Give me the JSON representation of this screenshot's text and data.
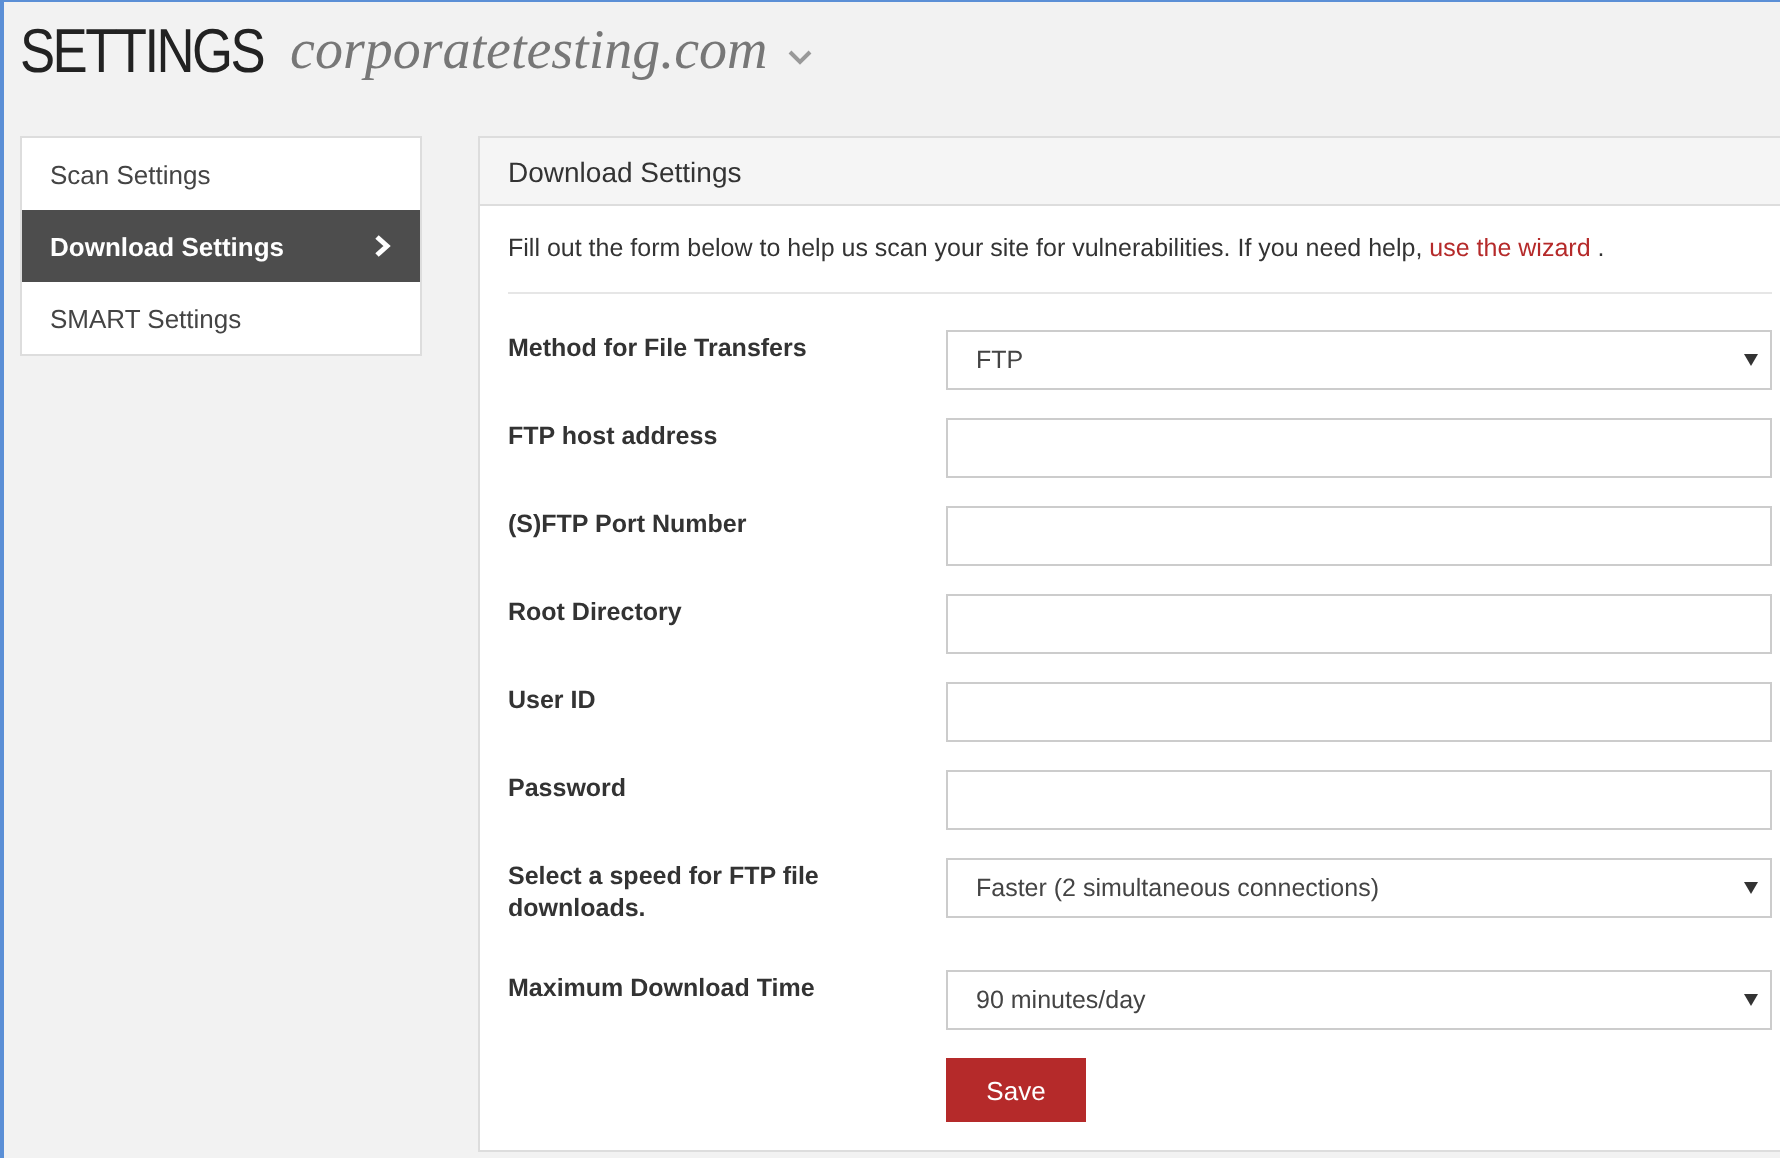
{
  "header": {
    "title": "SETTINGS",
    "site": "corporatetesting.com"
  },
  "sidebar": {
    "items": [
      {
        "label": "Scan Settings",
        "selected": false
      },
      {
        "label": "Download Settings",
        "selected": true
      },
      {
        "label": "SMART Settings",
        "selected": false
      }
    ]
  },
  "panel": {
    "title": "Download Settings",
    "description": {
      "text": "Fill out the form below to help us scan your site for vulnerabilities. If you need help, ",
      "link": "use the wizard",
      "after": " ."
    },
    "fields": [
      {
        "label": "Method for File Transfers",
        "kind": "select",
        "value": "FTP"
      },
      {
        "label": "FTP host address",
        "kind": "text"
      },
      {
        "label": "(S)FTP Port Number",
        "kind": "text"
      },
      {
        "label": "Root Directory",
        "kind": "text"
      },
      {
        "label": "User ID",
        "kind": "text"
      },
      {
        "label": "Password",
        "kind": "password"
      },
      {
        "label": "Select a speed for FTP file downloads.",
        "kind": "select",
        "value": "Faster (2 simultaneous connections)"
      },
      {
        "label": "Maximum Download Time",
        "kind": "select",
        "value": "90 minutes/day"
      }
    ],
    "save_button": "Save"
  }
}
